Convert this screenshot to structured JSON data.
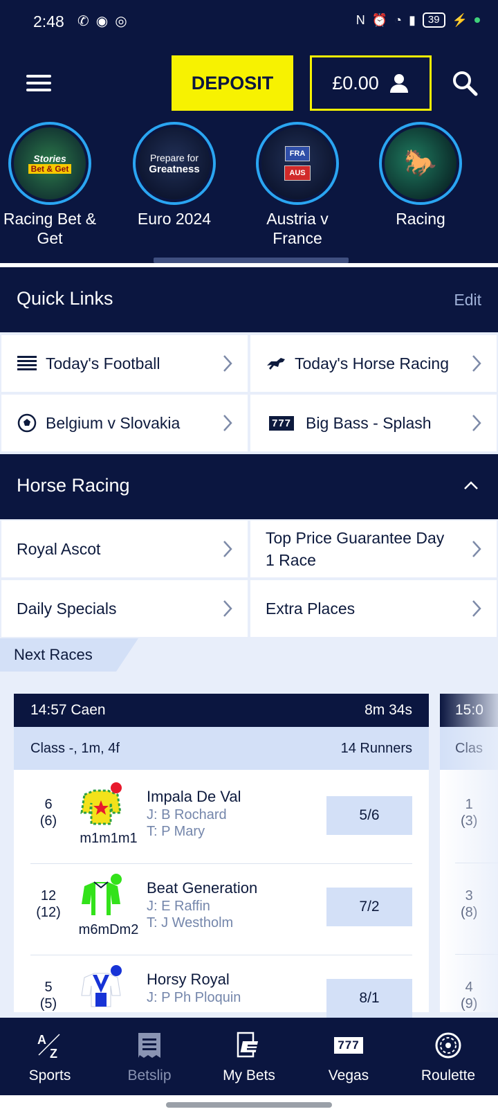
{
  "status_bar": {
    "time": "2:48",
    "battery": "39"
  },
  "header": {
    "deposit_label": "DEPOSIT",
    "balance": "£0.00"
  },
  "stories": [
    {
      "label": "Racing Bet & Get",
      "badge_top": "Stories",
      "badge_bottom": "Bet & Get"
    },
    {
      "label": "Euro 2024",
      "badge_top": "Prepare for",
      "badge_bottom": "Greatness"
    },
    {
      "label": "Austria v France",
      "badge_top": "FRA",
      "badge_bottom": "AUS"
    },
    {
      "label": "Racing"
    }
  ],
  "quick_links": {
    "title": "Quick Links",
    "edit_label": "Edit",
    "items": [
      {
        "label": "Today's Football",
        "icon": "list-icon"
      },
      {
        "label": "Today's Horse Racing",
        "icon": "horse-icon"
      },
      {
        "label": "Belgium v Slovakia",
        "icon": "football-icon"
      },
      {
        "label": "Big Bass - Splash",
        "icon": "slots-icon",
        "icon_text": "777"
      }
    ]
  },
  "horse_racing": {
    "title": "Horse Racing",
    "items": [
      {
        "label": "Royal Ascot"
      },
      {
        "label": "Top Price Guarantee Day 1 Race"
      },
      {
        "label": "Daily Specials"
      },
      {
        "label": "Extra Places"
      }
    ]
  },
  "next_races": {
    "tab_label": "Next Races",
    "race": {
      "title": "14:57 Caen",
      "countdown": "8m 34s",
      "info": "Class -, 1m, 4f",
      "runners_count": "14 Runners",
      "runners": [
        {
          "num": "6",
          "draw": "(6)",
          "form": "m1m1m1",
          "name": "Impala De Val",
          "jockey": "J: B Rochard",
          "trainer": "T: P Mary",
          "odds": "5/6",
          "colors": {
            "body": "#f3e21a",
            "accent": "#2ea043",
            "cap": "#e8192c"
          }
        },
        {
          "num": "12",
          "draw": "(12)",
          "form": "m6mDm2",
          "name": "Beat Generation",
          "jockey": "J: E Raffin",
          "trainer": "T: J Westholm",
          "odds": "7/2",
          "colors": {
            "body": "#33e21a",
            "accent": "#ffffff",
            "cap": "#33e21a"
          }
        },
        {
          "num": "5",
          "draw": "(5)",
          "form": "",
          "name": "Horsy Royal",
          "jockey": "J: P Ph Ploquin",
          "trainer": "",
          "odds": "8/1",
          "colors": {
            "body": "#ffffff",
            "accent": "#1733d6",
            "cap": "#1733d6"
          }
        }
      ]
    },
    "race2": {
      "title": "15:0",
      "info": "Clas",
      "runners": [
        {
          "num": "1",
          "draw": "(3)"
        },
        {
          "num": "3",
          "draw": "(8)"
        },
        {
          "num": "4",
          "draw": "(9)"
        }
      ]
    }
  },
  "bottom_nav": [
    {
      "label": "Sports",
      "icon": "az-icon"
    },
    {
      "label": "Betslip",
      "icon": "receipt-icon"
    },
    {
      "label": "My Bets",
      "icon": "bets-icon"
    },
    {
      "label": "Vegas",
      "icon": "slots-icon",
      "icon_text": "777"
    },
    {
      "label": "Roulette",
      "icon": "roulette-icon"
    }
  ],
  "colors": {
    "navy": "#0b1640",
    "yellow": "#f7f201",
    "accent_blue": "#2aa5f2",
    "light_blue": "#d3e0f7"
  }
}
